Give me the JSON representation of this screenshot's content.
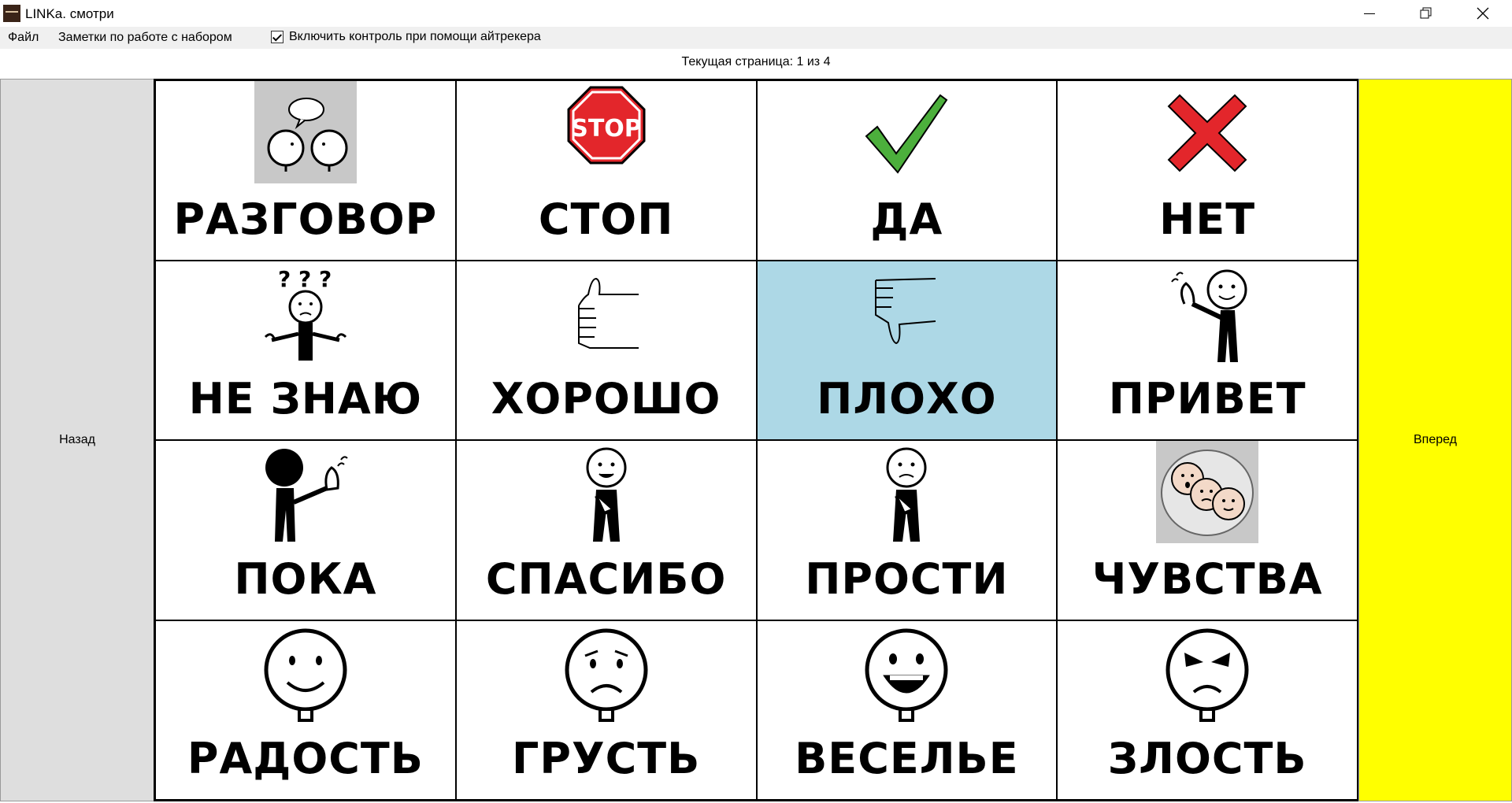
{
  "window": {
    "title": "LINKa. смотри"
  },
  "menu": {
    "file": "Файл",
    "notes": "Заметки по работе с набором",
    "eyetracker_label": "Включить контроль при помощи айтрекера",
    "eyetracker_checked": true
  },
  "page_indicator": "Текущая страница: 1 из 4",
  "nav": {
    "back": "Назад",
    "forward": "Вперед"
  },
  "colors": {
    "selected": "#add8e6",
    "forward_bg": "#ffff00",
    "back_bg": "#dedede"
  },
  "cards": [
    {
      "label": "РАЗГОВОР",
      "icon": "conversation-icon"
    },
    {
      "label": "СТОП",
      "icon": "stop-sign-icon"
    },
    {
      "label": "ДА",
      "icon": "checkmark-icon"
    },
    {
      "label": "НЕТ",
      "icon": "cross-icon"
    },
    {
      "label": "НЕ ЗНАЮ",
      "icon": "dont-know-icon"
    },
    {
      "label": "ХОРОШО",
      "icon": "thumbs-up-icon"
    },
    {
      "label": "ПЛОХО",
      "icon": "thumbs-down-icon",
      "selected": true
    },
    {
      "label": "ПРИВЕТ",
      "icon": "wave-hello-icon"
    },
    {
      "label": "ПОКА",
      "icon": "wave-bye-icon"
    },
    {
      "label": "СПАСИБО",
      "icon": "thank-you-icon"
    },
    {
      "label": "ПРОСТИ",
      "icon": "sorry-icon"
    },
    {
      "label": "ЧУВСТВА",
      "icon": "feelings-icon"
    },
    {
      "label": "РАДОСТЬ",
      "icon": "happy-face-icon"
    },
    {
      "label": "ГРУСТЬ",
      "icon": "sad-face-icon"
    },
    {
      "label": "ВЕСЕЛЬЕ",
      "icon": "laughing-face-icon"
    },
    {
      "label": "ЗЛОСТЬ",
      "icon": "angry-face-icon"
    }
  ]
}
